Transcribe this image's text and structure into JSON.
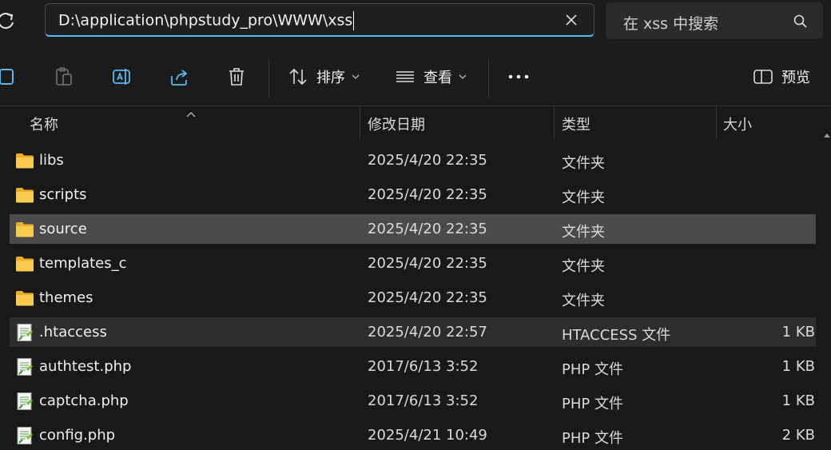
{
  "address_bar": {
    "path": "D:\\application\\phpstudy_pro\\WWW\\xss"
  },
  "search": {
    "placeholder": "在 xss 中搜索"
  },
  "toolbar": {
    "sort_label": "排序",
    "view_label": "查看",
    "more_label": "•••",
    "preview_label": "预览"
  },
  "columns": {
    "name": "名称",
    "date": "修改日期",
    "type": "类型",
    "size": "大小"
  },
  "files": [
    {
      "name": "libs",
      "date": "2025/4/20 22:35",
      "type": "文件夹",
      "size": "",
      "icon": "folder-icon"
    },
    {
      "name": "scripts",
      "date": "2025/4/20 22:35",
      "type": "文件夹",
      "size": "",
      "icon": "folder-icon"
    },
    {
      "name": "source",
      "date": "2025/4/20 22:35",
      "type": "文件夹",
      "size": "",
      "icon": "folder-icon",
      "state": "selected"
    },
    {
      "name": "templates_c",
      "date": "2025/4/20 22:35",
      "type": "文件夹",
      "size": "",
      "icon": "folder-icon"
    },
    {
      "name": "themes",
      "date": "2025/4/20 22:35",
      "type": "文件夹",
      "size": "",
      "icon": "folder-icon"
    },
    {
      "name": ".htaccess",
      "date": "2025/4/20 22:57",
      "type": "HTACCESS 文件",
      "size": "1 KB",
      "icon": "script-file-icon",
      "state": "hover"
    },
    {
      "name": "authtest.php",
      "date": "2017/6/13 3:52",
      "type": "PHP 文件",
      "size": "1 KB",
      "icon": "script-file-icon"
    },
    {
      "name": "captcha.php",
      "date": "2017/6/13 3:52",
      "type": "PHP 文件",
      "size": "1 KB",
      "icon": "script-file-icon"
    },
    {
      "name": "config.php",
      "date": "2025/4/21 10:49",
      "type": "PHP 文件",
      "size": "2 KB",
      "icon": "script-file-icon"
    }
  ],
  "colors": {
    "accent": "#4cc2ff",
    "selected_row": "#4a4a4a",
    "folder": "#f3c244"
  }
}
